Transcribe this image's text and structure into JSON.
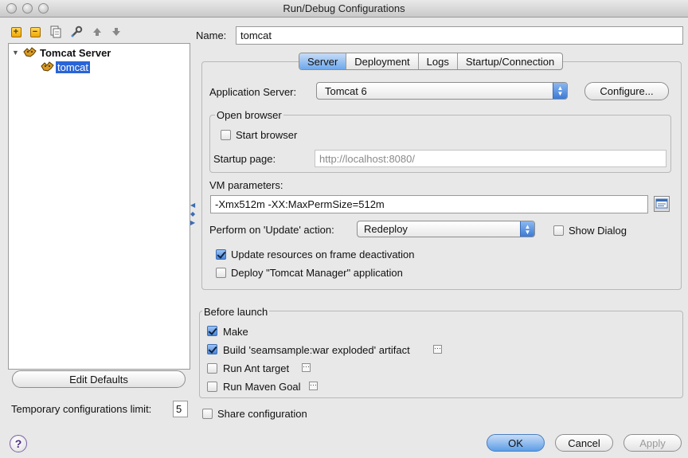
{
  "window": {
    "title": "Run/Debug Configurations"
  },
  "tree": {
    "group_label": "Tomcat Server",
    "config_label": "tomcat"
  },
  "left": {
    "edit_defaults_label": "Edit Defaults",
    "temp_limit_label": "Temporary configurations limit:",
    "temp_limit_value": "5"
  },
  "name": {
    "label": "Name:",
    "value": "tomcat"
  },
  "tabs": [
    "Server",
    "Deployment",
    "Logs",
    "Startup/Connection"
  ],
  "server": {
    "app_server_label": "Application Server:",
    "app_server_value": "Tomcat 6",
    "configure_label": "Configure...",
    "open_browser_title": "Open browser",
    "start_browser_label": "Start browser",
    "start_browser_checked": false,
    "startup_page_label": "Startup page:",
    "startup_page_value": "http://localhost:8080/",
    "vm_params_label": "VM parameters:",
    "vm_params_value": "-Xmx512m -XX:MaxPermSize=512m",
    "update_action_label": "Perform on 'Update' action:",
    "update_action_value": "Redeploy",
    "show_dialog_label": "Show Dialog",
    "show_dialog_checked": false,
    "update_resources_label": "Update resources on frame deactivation",
    "update_resources_checked": true,
    "deploy_manager_label": "Deploy \"Tomcat Manager\" application",
    "deploy_manager_checked": false
  },
  "before_launch": {
    "title": "Before launch",
    "items": [
      {
        "label": "Make",
        "checked": true
      },
      {
        "label": "Build 'seamsample:war exploded' artifact",
        "checked": true
      },
      {
        "label": "Run Ant target",
        "checked": false
      },
      {
        "label": "Run Maven Goal",
        "checked": false
      }
    ]
  },
  "share_label": "Share configuration",
  "buttons": {
    "ok": "OK",
    "cancel": "Cancel",
    "apply": "Apply",
    "help": "?"
  }
}
